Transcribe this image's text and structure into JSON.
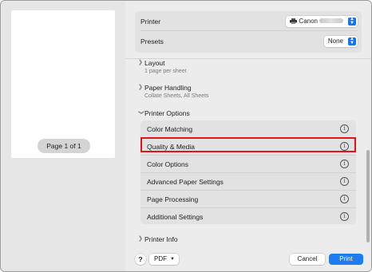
{
  "preview": {
    "page_indicator": "Page 1 of 1"
  },
  "printer_row": {
    "label": "Printer",
    "value": "Canon",
    "icon": "printer-icon"
  },
  "presets_row": {
    "label": "Presets",
    "value": "None"
  },
  "sections": {
    "layout": {
      "title": "Layout",
      "summary": "1 page per sheet"
    },
    "paper_handling": {
      "title": "Paper Handling",
      "summary": "Collate Sheets, All Sheets"
    },
    "printer_options": {
      "title": "Printer Options"
    },
    "printer_info": {
      "title": "Printer Info"
    }
  },
  "printer_options": [
    {
      "label": "Color Matching"
    },
    {
      "label": "Quality & Media",
      "highlighted": true
    },
    {
      "label": "Color Options"
    },
    {
      "label": "Advanced Paper Settings"
    },
    {
      "label": "Page Processing"
    },
    {
      "label": "Additional Settings"
    }
  ],
  "highlight_color": "#e0141c",
  "accent_color": "#1f7cf0",
  "footer": {
    "help_label": "?",
    "pdf_label": "PDF",
    "cancel_label": "Cancel",
    "print_label": "Print"
  }
}
